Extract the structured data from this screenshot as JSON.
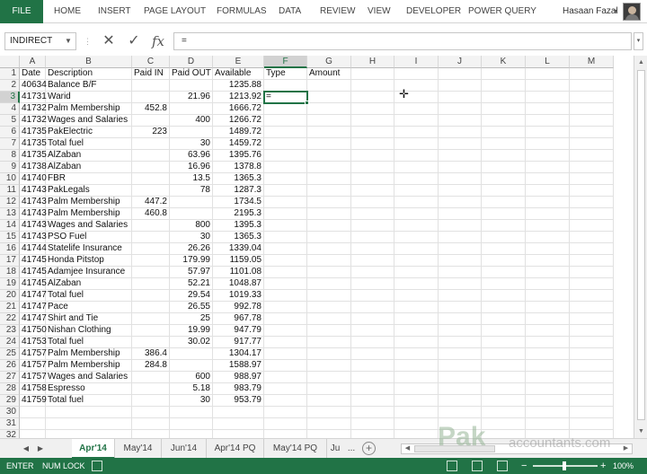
{
  "ribbon": {
    "file": "FILE",
    "tabs": [
      "HOME",
      "INSERT",
      "PAGE LAYOUT",
      "FORMULAS",
      "DATA",
      "REVIEW",
      "VIEW",
      "DEVELOPER",
      "POWER QUERY"
    ],
    "user": "Hasaan Fazal"
  },
  "formula_bar": {
    "name_box": "INDIRECT",
    "content": "="
  },
  "columns": [
    "A",
    "B",
    "C",
    "D",
    "E",
    "F",
    "G",
    "H",
    "I",
    "J",
    "K",
    "L",
    "M"
  ],
  "active_column": "F",
  "active_row": 3,
  "header_row": [
    "Date",
    "Description",
    "Paid IN",
    "Paid OUT",
    "Available",
    "Type",
    "Amount"
  ],
  "rows": [
    {
      "date": "40634",
      "desc": "Balance B/F",
      "in": "",
      "out": "",
      "avail": "1235.88"
    },
    {
      "date": "41731",
      "desc": "Warid",
      "in": "",
      "out": "21.96",
      "avail": "1213.92"
    },
    {
      "date": "41732",
      "desc": "Palm Membership",
      "in": "452.8",
      "out": "",
      "avail": "1666.72"
    },
    {
      "date": "41732",
      "desc": "Wages and Salaries",
      "in": "",
      "out": "400",
      "avail": "1266.72"
    },
    {
      "date": "41735",
      "desc": "PakElectric",
      "in": "223",
      "out": "",
      "avail": "1489.72"
    },
    {
      "date": "41735",
      "desc": "Total fuel",
      "in": "",
      "out": "30",
      "avail": "1459.72"
    },
    {
      "date": "41735",
      "desc": "AlZaban",
      "in": "",
      "out": "63.96",
      "avail": "1395.76"
    },
    {
      "date": "41738",
      "desc": "AlZaban",
      "in": "",
      "out": "16.96",
      "avail": "1378.8"
    },
    {
      "date": "41740",
      "desc": "FBR",
      "in": "",
      "out": "13.5",
      "avail": "1365.3"
    },
    {
      "date": "41743",
      "desc": "PakLegals",
      "in": "",
      "out": "78",
      "avail": "1287.3"
    },
    {
      "date": "41743",
      "desc": "Palm Membership",
      "in": "447.2",
      "out": "",
      "avail": "1734.5"
    },
    {
      "date": "41743",
      "desc": "Palm Membership",
      "in": "460.8",
      "out": "",
      "avail": "2195.3"
    },
    {
      "date": "41743",
      "desc": "Wages and Salaries",
      "in": "",
      "out": "800",
      "avail": "1395.3"
    },
    {
      "date": "41743",
      "desc": "PSO Fuel",
      "in": "",
      "out": "30",
      "avail": "1365.3"
    },
    {
      "date": "41744",
      "desc": "Statelife Insurance",
      "in": "",
      "out": "26.26",
      "avail": "1339.04"
    },
    {
      "date": "41745",
      "desc": "Honda Pitstop",
      "in": "",
      "out": "179.99",
      "avail": "1159.05"
    },
    {
      "date": "41745",
      "desc": "Adamjee Insurance",
      "in": "",
      "out": "57.97",
      "avail": "1101.08"
    },
    {
      "date": "41745",
      "desc": "AlZaban",
      "in": "",
      "out": "52.21",
      "avail": "1048.87"
    },
    {
      "date": "41747",
      "desc": "Total fuel",
      "in": "",
      "out": "29.54",
      "avail": "1019.33"
    },
    {
      "date": "41747",
      "desc": "Pace",
      "in": "",
      "out": "26.55",
      "avail": "992.78"
    },
    {
      "date": "41747",
      "desc": "Shirt and Tie",
      "in": "",
      "out": "25",
      "avail": "967.78"
    },
    {
      "date": "41750",
      "desc": "Nishan Clothing",
      "in": "",
      "out": "19.99",
      "avail": "947.79"
    },
    {
      "date": "41753",
      "desc": "Total fuel",
      "in": "",
      "out": "30.02",
      "avail": "917.77"
    },
    {
      "date": "41757",
      "desc": "Palm Membership",
      "in": "386.4",
      "out": "",
      "avail": "1304.17"
    },
    {
      "date": "41757",
      "desc": "Palm Membership",
      "in": "284.8",
      "out": "",
      "avail": "1588.97"
    },
    {
      "date": "41757",
      "desc": "Wages and Salaries",
      "in": "",
      "out": "600",
      "avail": "988.97"
    },
    {
      "date": "41758",
      "desc": "Espresso",
      "in": "",
      "out": "5.18",
      "avail": "983.79"
    },
    {
      "date": "41759",
      "desc": "Total fuel",
      "in": "",
      "out": "30",
      "avail": "953.79"
    }
  ],
  "active_cell_value": "=",
  "visible_row_count": 32,
  "sheets": [
    "Apr'14",
    "May'14",
    "Jun'14",
    "Apr'14 PQ",
    "May'14 PQ",
    "Ju"
  ],
  "active_sheet": "Apr'14",
  "sheet_ellipsis": "...",
  "status": {
    "mode": "ENTER",
    "num_lock": "NUM LOCK",
    "zoom": "100%"
  },
  "watermark": {
    "main": "Pak",
    "sub": "accountants.com"
  },
  "colors": {
    "accent": "#217346"
  }
}
